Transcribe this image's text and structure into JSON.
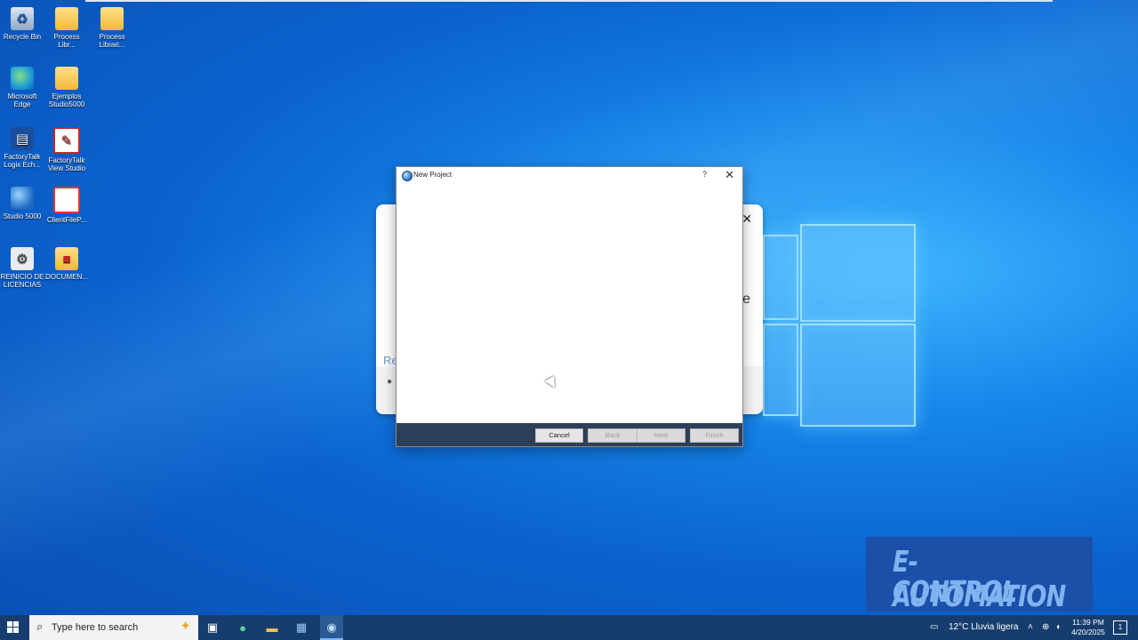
{
  "desktop": {
    "icons": [
      {
        "label": "Recycle Bin",
        "icon": "recycle-bin-icon"
      },
      {
        "label": "Process Libr...",
        "icon": "folder-icon"
      },
      {
        "label": "Process Librari...",
        "icon": "folder-icon"
      },
      {
        "label": "Microsoft Edge",
        "icon": "edge-icon"
      },
      {
        "label": "Ejemplos Studio5000",
        "icon": "folder-icon"
      },
      {
        "label": "FactoryTalk Logix Ech...",
        "icon": "factorytalk-logix-icon"
      },
      {
        "label": "FactoryTalk View Studio",
        "icon": "factorytalk-view-icon"
      },
      {
        "label": "Studio 5000",
        "icon": "studio5000-icon"
      },
      {
        "label": "ClientFileP...",
        "icon": "client-file-icon"
      },
      {
        "label": "REINICIO DE LICENCIAS",
        "icon": "shortcut-icon"
      },
      {
        "label": "DOCUMEN...",
        "icon": "folder-icon"
      }
    ]
  },
  "background_panel": {
    "partial_text_left": "Re",
    "partial_text_right": "e",
    "close_glyph": "✕"
  },
  "dialog": {
    "title": "New Project",
    "help_glyph": "?",
    "close_glyph": "✕",
    "buttons": {
      "cancel": "Cancel",
      "back": "Back",
      "next": "Next",
      "finish": "Finish"
    }
  },
  "watermark": {
    "line1": "E-AUTOMATION",
    "line2": "CONTROL"
  },
  "taskbar": {
    "search_placeholder": "Type here to search",
    "weather": "12°C  Lluvia ligera",
    "time": "11:39 PM",
    "date": "4/20/2025",
    "notification_count": "1"
  },
  "colors": {
    "desktop_blue": "#0b63cf",
    "dialog_footer": "#2d3e58",
    "taskbar": "#163d6e",
    "watermark_bg": "#1c4fa8"
  }
}
